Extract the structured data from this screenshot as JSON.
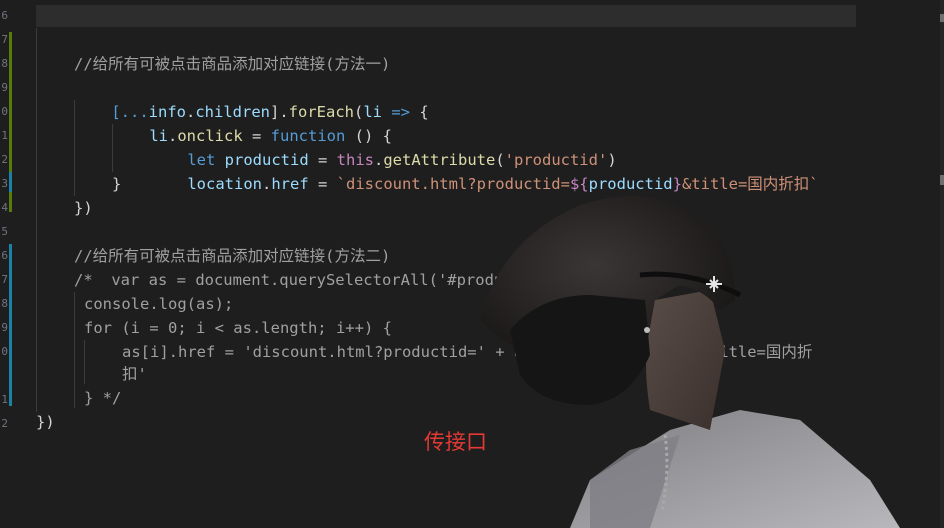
{
  "editor": {
    "line_numbers": [
      "6",
      "7",
      "8",
      "9",
      "0",
      "1",
      "2",
      "3",
      "4",
      "5",
      "6",
      "7",
      "8",
      "9",
      "0",
      "1",
      "2"
    ],
    "comment1": "//给所有可被点击商品添加对应链接(方法一)",
    "l2": {
      "open": "[...",
      "info": "info",
      "dot1": ".",
      "children": "children",
      "close": "].",
      "forEach": "forEach",
      "paren": "(",
      "li": "li",
      "arrow": " => ",
      "brace": "{"
    },
    "l3": {
      "li": "li",
      "dot": ".",
      "onclick": "onclick",
      "eq": " = ",
      "function": "function",
      "rest": " () {"
    },
    "l4": {
      "let": "let",
      "productid": " productid",
      "eq": " = ",
      "this": "this",
      "dot": ".",
      "getAttribute": "getAttribute",
      "p1": "(",
      "arg": "'productid'",
      "p2": ")"
    },
    "l5": {
      "location": "location",
      "dot": ".",
      "href": "href",
      "eq": " = ",
      "tpl1": "`discount.html?productid=",
      "interp_open": "${",
      "interp_var": "productid",
      "interp_close": "}",
      "tpl2": "&title=国内折扣`"
    },
    "l6": "}",
    "l7": "})",
    "comment2": "//给所有可被点击商品添加对应链接(方法二)",
    "c1": "/*  var as = document.querySelectorAll('#product>ul>li>a')",
    "c2": "console.log(as);",
    "c3": "for (i = 0; i < as.length; i++) {",
    "c4": "as[i].href = 'discount.html?productid=' + arr[i].productId + '&title=国内折",
    "c5": "扣'",
    "c6": "} */",
    "c7": "})"
  },
  "watermark": "传接口",
  "colors": {
    "background": "#1e1e1e",
    "keyword": "#c586c0",
    "function": "#dcdcaa",
    "string": "#ce9178",
    "variable": "#9cdcfe",
    "accent_blue": "#569cd6",
    "watermark": "#e53935",
    "git_added": "#587c0c",
    "git_modified": "#1b81a8"
  }
}
